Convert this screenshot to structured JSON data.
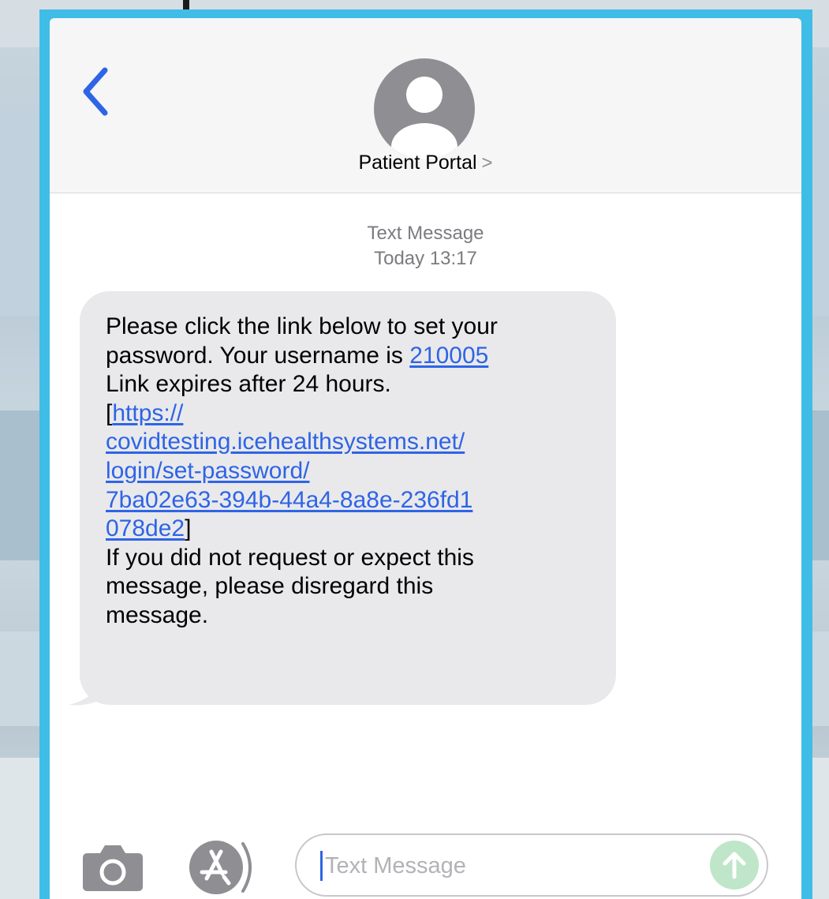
{
  "header": {
    "back_icon": "chevron-left-icon",
    "avatar_icon": "person-silhouette-icon",
    "contact_name": "Patient Portal",
    "contact_chevron": ">"
  },
  "thread": {
    "service_label": "Text Message",
    "timestamp": "Today 13:17"
  },
  "message": {
    "line_1": "Please click the link below to set your",
    "line_2_prefix": "password. Your username is ",
    "username_link": "210005",
    "line_3": "Link expires after 24 hours.",
    "bracket_open": "[",
    "url_part_1": "https://",
    "url_part_2": "covidtesting.icehealthsystems.net/",
    "url_part_3": "login/set-password/",
    "url_part_4": "7ba02e63-394b-44a4-8a8e-236fd1",
    "url_part_5": "078de2",
    "bracket_close": "]",
    "line_4": "If you did not request or expect this",
    "line_5": "message, please disregard this",
    "line_6": "message."
  },
  "composer": {
    "camera_icon": "camera-icon",
    "apps_icon": "app-store-icon",
    "placeholder": "Text Message",
    "send_icon": "arrow-up-icon"
  },
  "colors": {
    "frame_border": "#3fbde6",
    "link_blue": "#2e64e6",
    "bubble_gray": "#e9e9eb",
    "send_disabled_green": "#bfe6c9"
  }
}
